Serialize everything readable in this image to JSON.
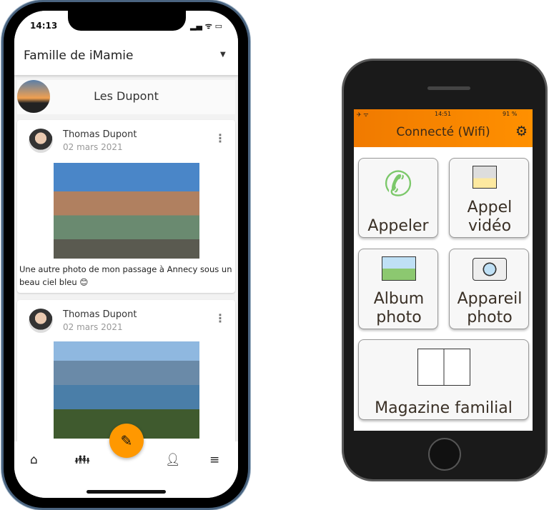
{
  "left_phone": {
    "status": {
      "time": "14:13"
    },
    "header": {
      "title": "Famille de iMamie"
    },
    "group": {
      "name": "Les Dupont"
    },
    "posts": [
      {
        "author": "Thomas Dupont",
        "date": "02 mars 2021",
        "caption": "Une autre photo de mon passage à Annecy sous un beau ciel bleu 😊"
      },
      {
        "author": "Thomas Dupont",
        "date": "02 mars 2021"
      }
    ],
    "nav": {
      "icons": [
        "home-icon",
        "family-icon",
        "person-icon",
        "menu-icon"
      ]
    },
    "fab": {
      "icon": "edit-icon",
      "color": "#ff9800"
    }
  },
  "right_phone": {
    "status": {
      "time": "14:51",
      "battery": "91 %"
    },
    "header": {
      "title": "Connecté (Wifi)",
      "accent": "#f58400"
    },
    "tiles": [
      {
        "label": "Appeler",
        "icon": "phone-icon"
      },
      {
        "label": "Appel vidéo",
        "icon": "video-call-icon"
      },
      {
        "label": "Album photo",
        "icon": "photo-album-icon"
      },
      {
        "label": "Appareil photo",
        "icon": "camera-icon"
      },
      {
        "label": "Magazine familial",
        "icon": "magazine-icon"
      }
    ]
  }
}
